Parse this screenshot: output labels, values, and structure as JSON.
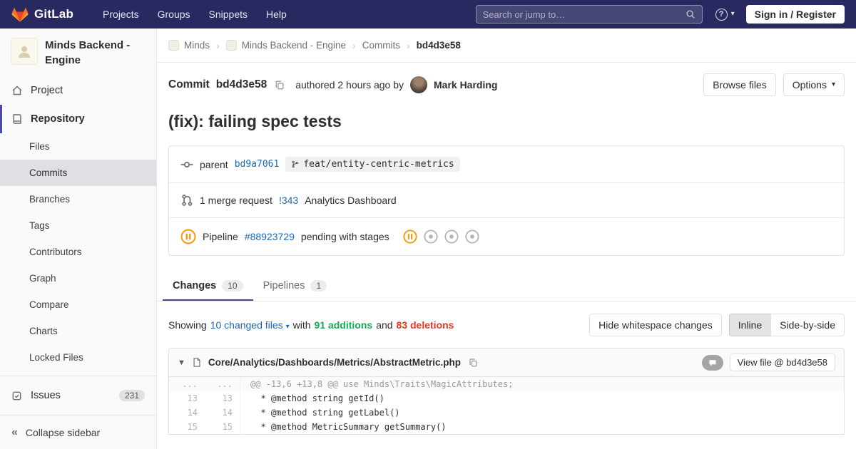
{
  "colors": {
    "navbar_bg": "#292961",
    "link_blue": "#1b69b6",
    "additions_green": "#1aaa55",
    "deletions_red": "#db3b21",
    "pending_orange": "#fc9403",
    "sidebar_accent": "#4b4ba3"
  },
  "navbar": {
    "brand": "GitLab",
    "items": [
      {
        "label": "Projects"
      },
      {
        "label": "Groups"
      },
      {
        "label": "Snippets"
      },
      {
        "label": "Help"
      }
    ],
    "search_placeholder": "Search or jump to…",
    "signin_label": "Sign in / Register"
  },
  "sidebar": {
    "project_title": "Minds Backend - Engine",
    "project_label": "Project",
    "repository_label": "Repository",
    "repo_items": [
      "Files",
      "Commits",
      "Branches",
      "Tags",
      "Contributors",
      "Graph",
      "Compare",
      "Charts",
      "Locked Files"
    ],
    "issues_label": "Issues",
    "issues_count": "231",
    "collapse_label": "Collapse sidebar"
  },
  "breadcrumb": {
    "items": [
      "Minds",
      "Minds Backend - Engine",
      "Commits",
      "bd4d3e58"
    ]
  },
  "commit": {
    "label": "Commit",
    "sha": "bd4d3e58",
    "authored": "authored 2 hours ago by",
    "author": "Mark Harding",
    "browse_files": "Browse files",
    "options": "Options",
    "title": "(fix): failing spec tests",
    "parent_label": "parent",
    "parent_sha": "bd9a7061",
    "branch": "feat/entity-centric-metrics",
    "mr_text": "1 merge request",
    "mr_ref": "!343",
    "mr_title": "Analytics Dashboard",
    "pipeline_label": "Pipeline",
    "pipeline_id": "#88923729",
    "pipeline_status": "pending with stages"
  },
  "tabs": [
    {
      "label": "Changes",
      "count": "10"
    },
    {
      "label": "Pipelines",
      "count": "1"
    }
  ],
  "stats": {
    "showing": "Showing",
    "changed_files": "10 changed files",
    "with": "with",
    "additions": "91 additions",
    "and": "and",
    "deletions": "83 deletions",
    "hide_whitespace": "Hide whitespace changes",
    "inline": "Inline",
    "side_by_side": "Side-by-side"
  },
  "diff": {
    "file_path": "Core/Analytics/Dashboards/Metrics/AbstractMetric.php",
    "view_file": "View file @ bd4d3e58",
    "lines": [
      {
        "old": "...",
        "new": "...",
        "code": "@@ -13,6 +13,8 @@ use Minds\\Traits\\MagicAttributes;",
        "type": "match"
      },
      {
        "old": "13",
        "new": "13",
        "code": "  * @method string getId()",
        "type": "context"
      },
      {
        "old": "14",
        "new": "14",
        "code": "  * @method string getLabel()",
        "type": "context"
      },
      {
        "old": "15",
        "new": "15",
        "code": "  * @method MetricSummary getSummary()",
        "type": "context"
      }
    ]
  }
}
